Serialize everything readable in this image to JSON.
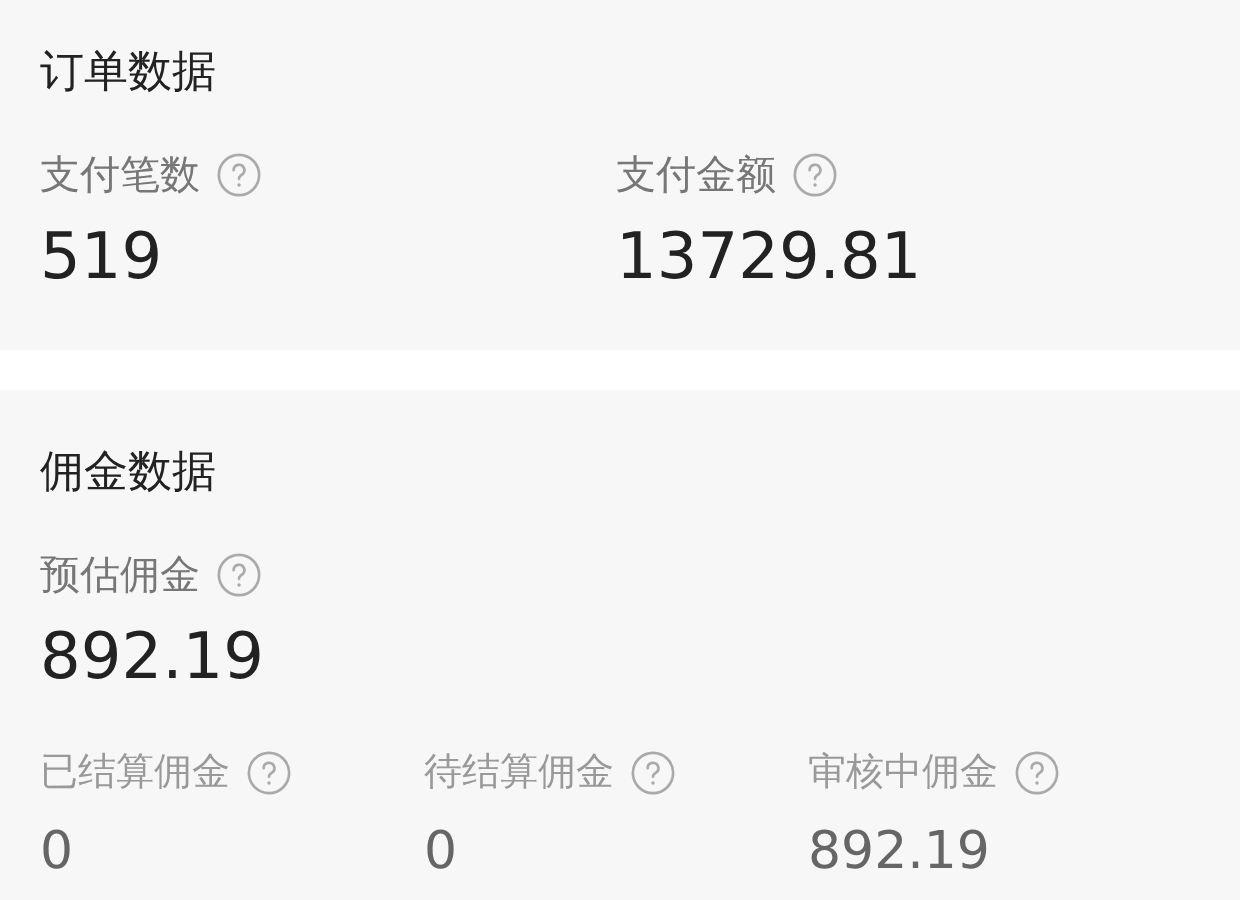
{
  "sections": [
    {
      "title": "订单数据",
      "rows": [
        {
          "kind": "large",
          "items": [
            {
              "label": "支付笔数",
              "value": "519"
            },
            {
              "label": "支付金额",
              "value": "13729.81"
            }
          ]
        }
      ]
    },
    {
      "title": "佣金数据",
      "rows": [
        {
          "kind": "large",
          "items": [
            {
              "label": "预估佣金",
              "value": "892.19"
            }
          ]
        },
        {
          "kind": "small",
          "items": [
            {
              "label": "已结算佣金",
              "value": "0"
            },
            {
              "label": "待结算佣金",
              "value": "0"
            },
            {
              "label": "审核中佣金",
              "value": "892.19"
            }
          ]
        }
      ]
    }
  ]
}
